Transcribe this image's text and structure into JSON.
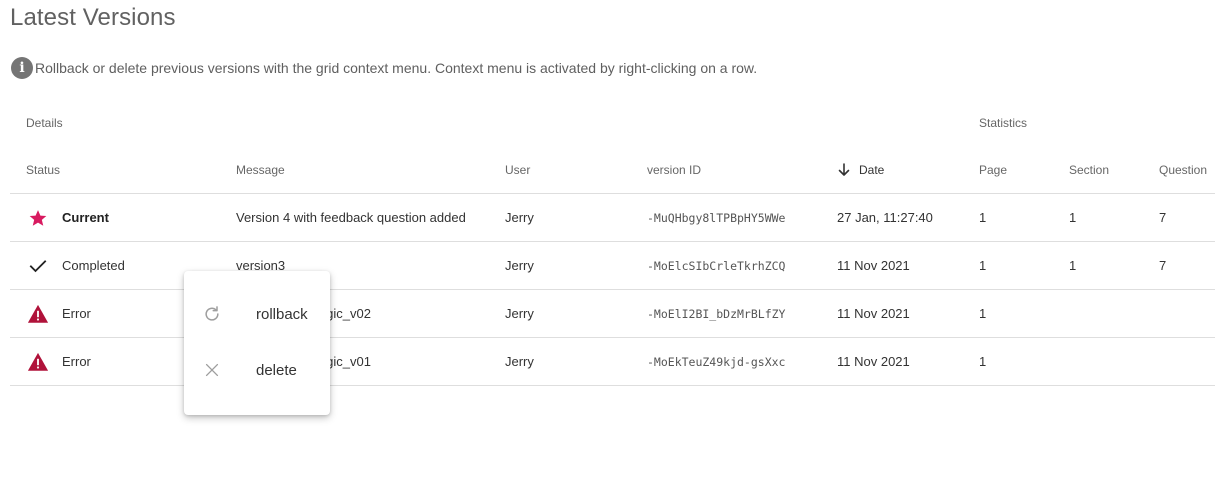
{
  "page": {
    "title": "Latest Versions",
    "info_text": "Rollback or delete previous versions with the grid context menu. Context menu is activated by right-clicking on a row."
  },
  "grid": {
    "groups": {
      "details": "Details",
      "statistics": "Statistics"
    },
    "columns": {
      "status": "Status",
      "message": "Message",
      "user": "User",
      "version_id": "version ID",
      "date": "Date",
      "page": "Page",
      "section": "Section",
      "question": "Question"
    },
    "sort": {
      "column": "date",
      "direction": "descending"
    },
    "rows": [
      {
        "status": "Current",
        "status_icon": "star-icon",
        "status_color": "#d81b60",
        "message": "Version 4 with feedback question added",
        "user": "Jerry",
        "version_id": "-MuQHbgy8lTPBpHY5WWe",
        "date": "27 Jan, 11:27:40",
        "page": "1",
        "section": "1",
        "question": "7"
      },
      {
        "status": "Completed",
        "status_icon": "check-icon",
        "status_color": "#222222",
        "message": "version3",
        "user": "Jerry",
        "version_id": "-MoElcSIbCrleTkrhZCQ",
        "date": "11 Nov 2021",
        "page": "1",
        "section": "1",
        "question": "7"
      },
      {
        "status": "Error",
        "status_icon": "warning-icon",
        "status_color": "#b0123a",
        "message": "logic_v02",
        "user": "Jerry",
        "version_id": "-MoElI2BI_bDzMrBLfZY",
        "date": "11 Nov 2021",
        "page": "1",
        "section": "",
        "question": ""
      },
      {
        "status": "Error",
        "status_icon": "warning-icon",
        "status_color": "#b0123a",
        "message": "logic_v01",
        "user": "Jerry",
        "version_id": "-MoEkTeuZ49kjd-gsXxc",
        "date": "11 Nov 2021",
        "page": "1",
        "section": "",
        "question": ""
      }
    ]
  },
  "context_menu": {
    "items": [
      {
        "label": "rollback",
        "icon": "refresh-icon"
      },
      {
        "label": "delete",
        "icon": "close-icon"
      }
    ]
  },
  "colors": {
    "star": "#d81b60",
    "error": "#b0123a",
    "info_icon": "#757575"
  }
}
